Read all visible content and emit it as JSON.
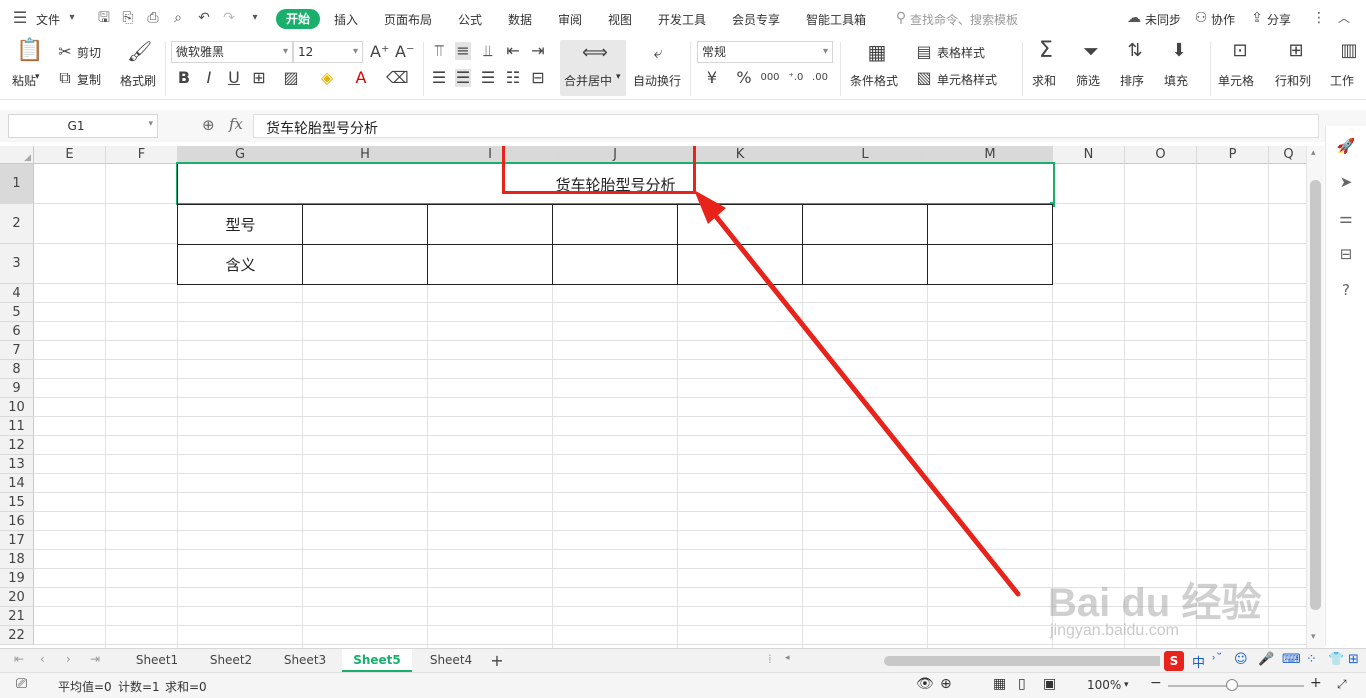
{
  "menubar": {
    "file": "文件",
    "tabs": [
      "开始",
      "插入",
      "页面布局",
      "公式",
      "数据",
      "审阅",
      "视图",
      "开发工具",
      "会员专享",
      "智能工具箱"
    ],
    "active_tab": "开始",
    "search_placeholder": "查找命令、搜索模板",
    "sync": "未同步",
    "collab": "协作",
    "share": "分享"
  },
  "ribbon": {
    "paste": "粘贴",
    "cut": "剪切",
    "copy": "复制",
    "format_painter": "格式刷",
    "font_name": "微软雅黑",
    "font_size": "12",
    "merge_center": "合并居中",
    "wrap": "自动换行",
    "number_format": "常规",
    "conditional_format": "条件格式",
    "table_style": "表格样式",
    "cell_style": "单元格样式",
    "sum": "求和",
    "filter": "筛选",
    "sort": "排序",
    "fill": "填充",
    "cells": "单元格",
    "rows_cols": "行和列",
    "worksheet": "工作"
  },
  "formula_bar": {
    "cell_ref": "G1",
    "fx": "fx",
    "content": "货车轮胎型号分析"
  },
  "sheet": {
    "columns": [
      "E",
      "F",
      "G",
      "H",
      "I",
      "J",
      "K",
      "L",
      "M",
      "N",
      "O",
      "P",
      "Q"
    ],
    "rows": [
      "1",
      "2",
      "3",
      "4",
      "5",
      "6",
      "7",
      "8",
      "9",
      "10",
      "11",
      "12",
      "13",
      "14",
      "15",
      "16",
      "17",
      "18",
      "19",
      "20",
      "21",
      "22"
    ],
    "title": "货车轮胎型号分析",
    "label_model": "型号",
    "label_meaning": "含义"
  },
  "tabs": {
    "sheets": [
      "Sheet1",
      "Sheet2",
      "Sheet3",
      "Sheet5",
      "Sheet4"
    ],
    "active": "Sheet5",
    "add": "+"
  },
  "status": {
    "avg": "平均值=0",
    "count": "计数=1",
    "sum": "求和=0",
    "zoom": "100%"
  },
  "watermark": {
    "brand": "Bai du 经验",
    "url": "jingyan.baidu.com"
  },
  "colors": {
    "accent": "#1aaf6b",
    "annotation": "#e8231c"
  }
}
